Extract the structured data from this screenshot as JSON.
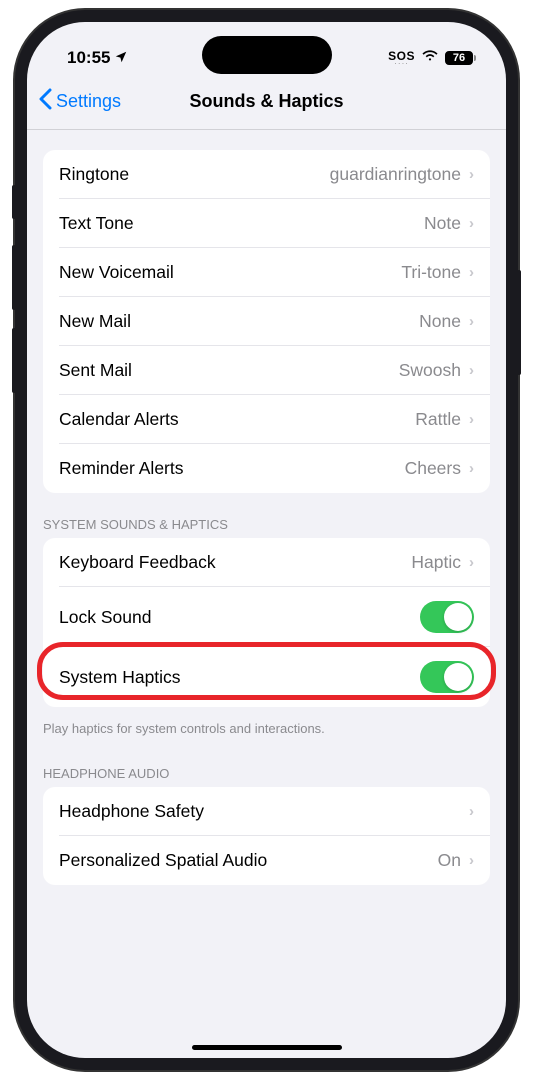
{
  "status": {
    "time": "10:55",
    "sos": "SOS",
    "battery": "76"
  },
  "nav": {
    "back": "Settings",
    "title": "Sounds & Haptics"
  },
  "sounds_group": [
    {
      "label": "Ringtone",
      "value": "guardianringtone",
      "type": "nav"
    },
    {
      "label": "Text Tone",
      "value": "Note",
      "type": "nav"
    },
    {
      "label": "New Voicemail",
      "value": "Tri-tone",
      "type": "nav"
    },
    {
      "label": "New Mail",
      "value": "None",
      "type": "nav"
    },
    {
      "label": "Sent Mail",
      "value": "Swoosh",
      "type": "nav"
    },
    {
      "label": "Calendar Alerts",
      "value": "Rattle",
      "type": "nav"
    },
    {
      "label": "Reminder Alerts",
      "value": "Cheers",
      "type": "nav"
    }
  ],
  "system_section": {
    "header": "SYSTEM SOUNDS & HAPTICS",
    "rows": [
      {
        "label": "Keyboard Feedback",
        "value": "Haptic",
        "type": "nav"
      },
      {
        "label": "Lock Sound",
        "type": "toggle",
        "on": true
      },
      {
        "label": "System Haptics",
        "type": "toggle",
        "on": true
      }
    ],
    "footer": "Play haptics for system controls and interactions."
  },
  "headphone_section": {
    "header": "HEADPHONE AUDIO",
    "rows": [
      {
        "label": "Headphone Safety",
        "value": "",
        "type": "nav"
      },
      {
        "label": "Personalized Spatial Audio",
        "value": "On",
        "type": "nav"
      }
    ]
  }
}
